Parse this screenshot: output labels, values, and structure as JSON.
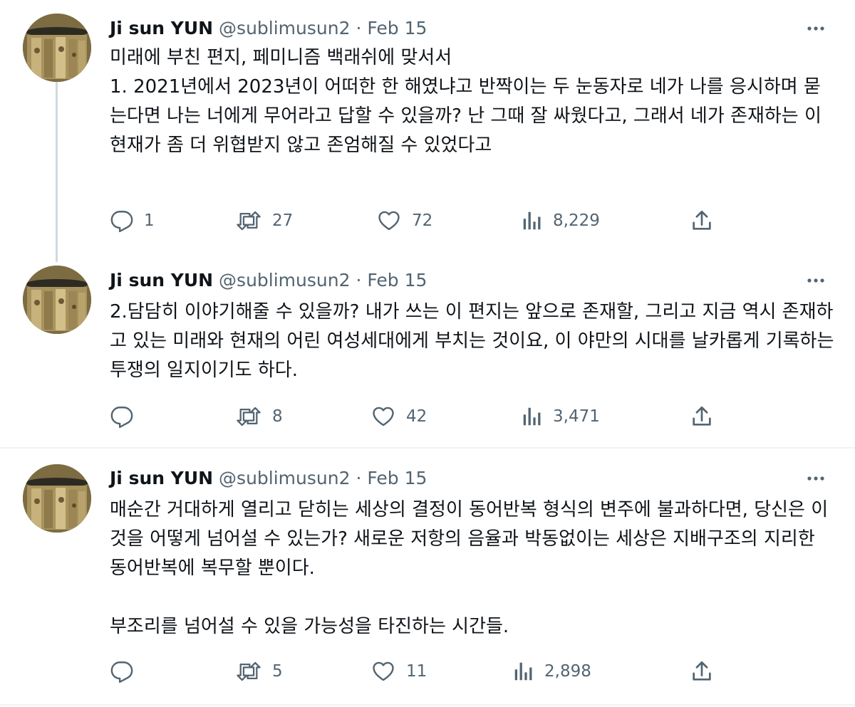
{
  "tweets": [
    {
      "name": "Ji sun YUN",
      "handle": "@sublimusun2",
      "separator": "·",
      "date": "Feb 15",
      "paragraphs": [
        "미래에 부친 편지, 페미니즘 백래쉬에 맞서서",
        "1. 2021년에서 2023년이 어떠한 한 해였냐고 반짝이는 두 눈동자로 네가 나를 응시하며 묻는다면 나는 너에게 무어라고 답할 수 있을까? 난 그때 잘 싸웠다고, 그래서 네가 존재하는 이 현재가 좀 더 위협받지 않고 존엄해질 수 있었다고"
      ],
      "replies": "1",
      "retweets": "27",
      "likes": "72",
      "views": "8,229"
    },
    {
      "name": "Ji sun YUN",
      "handle": "@sublimusun2",
      "separator": "·",
      "date": "Feb 15",
      "paragraphs": [
        "2.담담히 이야기해줄 수 있을까? 내가 쓰는 이 편지는 앞으로 존재할, 그리고 지금 역시 존재하고 있는 미래와 현재의 어린 여성세대에게 부치는 것이요, 이 야만의 시대를 날카롭게 기록하는 투쟁의 일지이기도 하다."
      ],
      "replies": "",
      "retweets": "8",
      "likes": "42",
      "views": "3,471"
    },
    {
      "name": "Ji sun YUN",
      "handle": "@sublimusun2",
      "separator": "·",
      "date": "Feb 15",
      "paragraphs": [
        "매순간 거대하게 열리고 닫히는 세상의 결정이 동어반복 형식의 변주에 불과하다면, 당신은 이것을 어떻게 넘어설 수 있는가? 새로운 저항의 음율과 박동없이는 세상은 지배구조의 지리한 동어반복에 복무할 뿐이다.",
        "",
        "부조리를 넘어설 수 있을 가능성을 타진하는 시간들."
      ],
      "replies": "",
      "retweets": "5",
      "likes": "11",
      "views": "2,898"
    }
  ],
  "icons": {
    "reply": "reply-icon",
    "retweet": "retweet-icon",
    "like": "heart-icon",
    "views": "views-icon",
    "share": "share-icon",
    "more": "more-icon"
  },
  "colors": {
    "text": "#0f1419",
    "secondary": "#536471",
    "thread_line": "#cfd9de",
    "divider": "#eff3f4"
  }
}
